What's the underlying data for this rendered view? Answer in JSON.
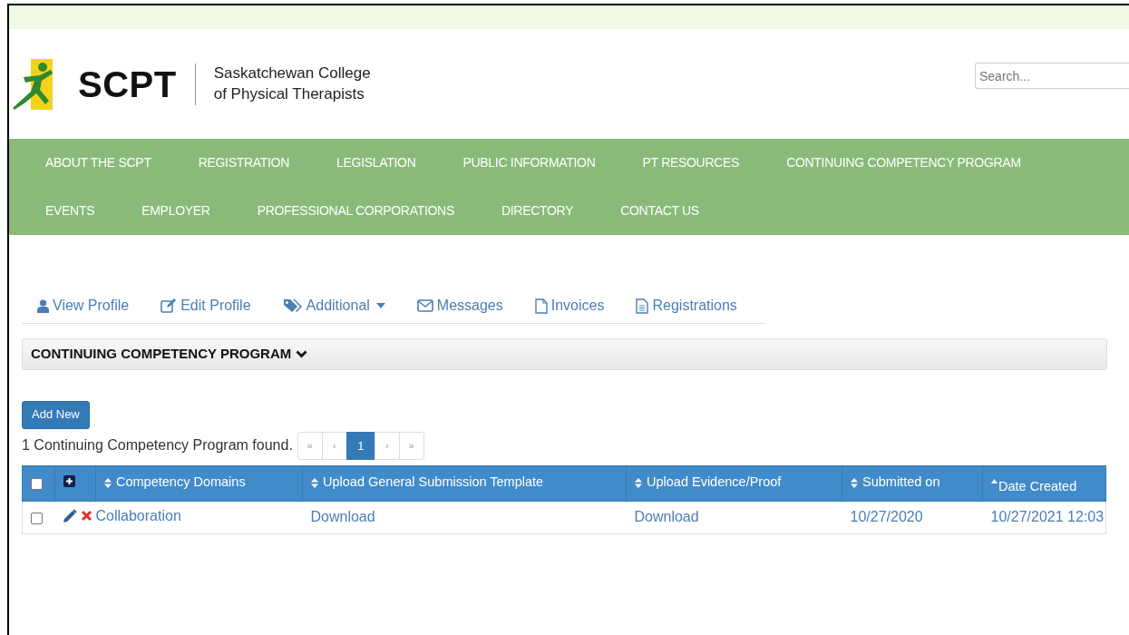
{
  "header": {
    "logo_text": "SCPT",
    "org_name_lines": [
      "Saskatchewan College",
      "of Physical Therapists"
    ],
    "search": {
      "placeholder": "Search..."
    }
  },
  "main_menu": [
    "ABOUT THE SCPT",
    "REGISTRATION",
    "LEGISLATION",
    "PUBLIC INFORMATION",
    "PT RESOURCES",
    "CONTINUING COMPETENCY PROGRAM",
    "EVENTS",
    "EMPLOYER",
    "PROFESSIONAL CORPORATIONS",
    "DIRECTORY",
    "CONTACT US"
  ],
  "profile_tabs": [
    {
      "label": "View Profile",
      "dropdown": false,
      "selected": false
    },
    {
      "label": "Edit Profile",
      "dropdown": false,
      "selected": false
    },
    {
      "label": "Additional",
      "dropdown": true,
      "selected": false
    },
    {
      "label": "Messages",
      "dropdown": false,
      "selected": false
    },
    {
      "label": "Invoices",
      "dropdown": false,
      "selected": false
    },
    {
      "label": "Registrations",
      "dropdown": false,
      "selected": false
    }
  ],
  "section": {
    "title": "CONTINUING COMPETENCY PROGRAM",
    "expanded": true
  },
  "add_button": "Add New",
  "result_count": "1 Continuing Competency Program found.",
  "pagination": [
    {
      "label": "«",
      "selected": false
    },
    {
      "label": "‹",
      "selected": false
    },
    {
      "label": "1",
      "selected": true
    },
    {
      "label": "›",
      "selected": false
    },
    {
      "label": "»",
      "selected": false
    }
  ],
  "table": {
    "select_all_checked": false,
    "columns": [
      {
        "label": "Competency Domains",
        "sorted": false
      },
      {
        "label": "Upload General Submission Template",
        "sorted": false
      },
      {
        "label": "Upload Evidence/Proof",
        "sorted": false
      },
      {
        "label": "Submitted on",
        "sorted": false
      },
      {
        "label": "Date Created",
        "sorted": true
      }
    ],
    "rows": [
      {
        "checked": false,
        "cells": [
          "Collaboration",
          "Download",
          "Download",
          "10/27/2020",
          "10/27/2021 12:03"
        ]
      }
    ]
  }
}
